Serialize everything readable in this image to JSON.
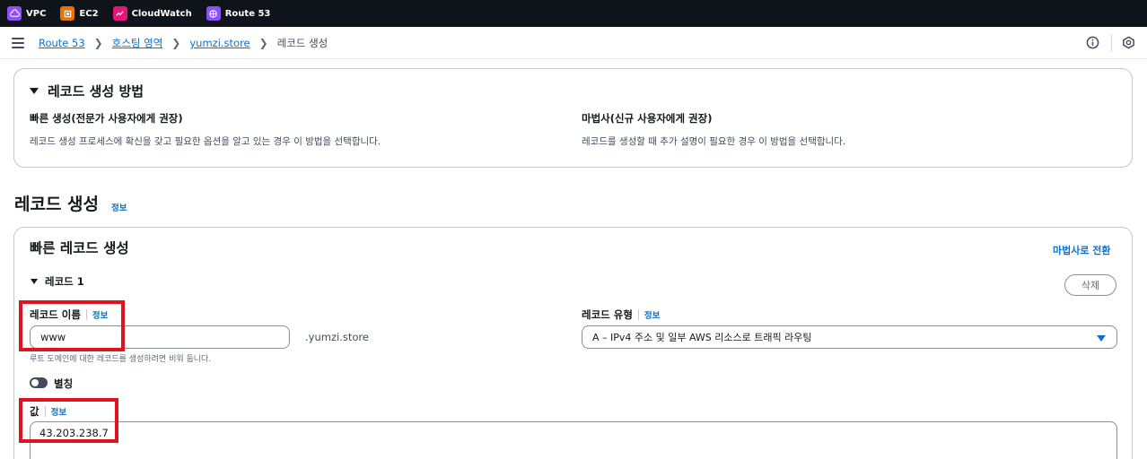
{
  "service_bar": [
    {
      "label": "VPC",
      "icon": "vpc-icon",
      "color": "#8c4fff"
    },
    {
      "label": "EC2",
      "icon": "ec2-icon",
      "color": "#ed7100"
    },
    {
      "label": "CloudWatch",
      "icon": "cloudwatch-icon",
      "color": "#e7157b"
    },
    {
      "label": "Route 53",
      "icon": "route53-icon",
      "color": "#8c4fff"
    }
  ],
  "breadcrumb": {
    "items": [
      "Route 53",
      "호스팅 영역",
      "yumzi.store"
    ],
    "current": "레코드 생성"
  },
  "method_panel": {
    "title": "레코드 생성 방법",
    "quick": {
      "title": "빠른 생성(전문가 사용자에게 권장)",
      "desc": "레코드 생성 프로세스에 확신을 갖고 필요한 옵션을 알고 있는 경우 이 방법을 선택합니다."
    },
    "wizard": {
      "title": "마법사(신규 사용자에게 권장)",
      "desc": "레코드를 생성할 때 추가 설명이 필요한 경우 이 방법을 선택합니다."
    }
  },
  "page": {
    "heading": "레코드 생성",
    "info": "정보"
  },
  "quick_create": {
    "title": "빠른 레코드 생성",
    "switch_link": "마법사로 전환",
    "record_label": "레코드 1",
    "delete_button": "삭제",
    "name": {
      "label": "레코드 이름",
      "info": "정보",
      "value": "www",
      "suffix": ".yumzi.store",
      "hint": "루트 도메인에 대한 레코드를 생성하려면 비워 둡니다."
    },
    "type": {
      "label": "레코드 유형",
      "info": "정보",
      "value": "A – IPv4 주소 및 일부 AWS 리소스로 트래픽 라우팅"
    },
    "alias": {
      "label": "별칭"
    },
    "value": {
      "label": "값",
      "info": "정보",
      "value": "43.203.238.7"
    }
  },
  "highlight_color": "#e0141e"
}
